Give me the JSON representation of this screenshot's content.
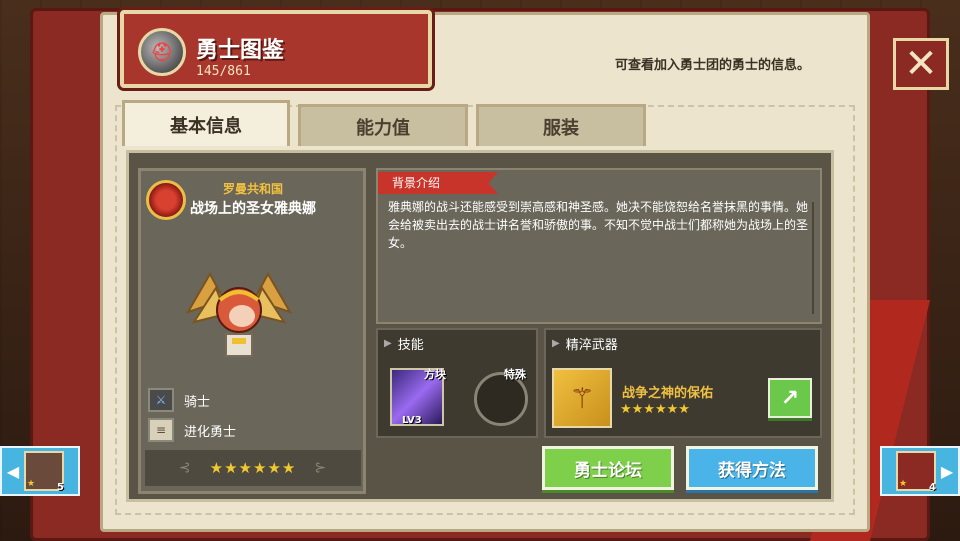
{
  "header": {
    "title": "勇士图鉴",
    "count": "145/861",
    "hint": "可查看加入勇士团的勇士的信息。",
    "close_glyph": "✕"
  },
  "tabs": [
    {
      "label": "基本信息",
      "active": true
    },
    {
      "label": "能力值",
      "active": false
    },
    {
      "label": "服装",
      "active": false
    }
  ],
  "hero": {
    "faction": "罗曼共和国",
    "name": "战场上的圣女雅典娜",
    "class_label": "骑士",
    "type_label": "进化勇士",
    "stars": "★★★★★★",
    "deco_left": "⊰",
    "deco_right": "⊱"
  },
  "background": {
    "heading": "背景介绍",
    "text": "雅典娜的战斗还能感受到崇高感和神圣感。她决不能饶恕给名誉抹黑的事情。她会给被卖出去的战士讲名誉和骄傲的事。不知不觉中战士们都称她为战场上的圣女。"
  },
  "skills": {
    "heading": "技能",
    "skill_tag": "方块",
    "skill_level": "LV3",
    "special_tag": "特殊"
  },
  "weapon": {
    "heading": "精淬武器",
    "name": "战争之神的保佑",
    "stars": "★★★★★★",
    "go_glyph": "↗"
  },
  "buttons": {
    "forum": "勇士论坛",
    "obtain": "获得方法"
  },
  "nav": {
    "prev_level": "5",
    "next_level": "4",
    "prev_glyph": "◀",
    "next_glyph": "▶",
    "star_glyph": "★"
  },
  "colors": {
    "accent_red": "#a8362c",
    "gold": "#f0c040",
    "green_button": "#7ed04a",
    "blue_button": "#4ab4e8"
  }
}
